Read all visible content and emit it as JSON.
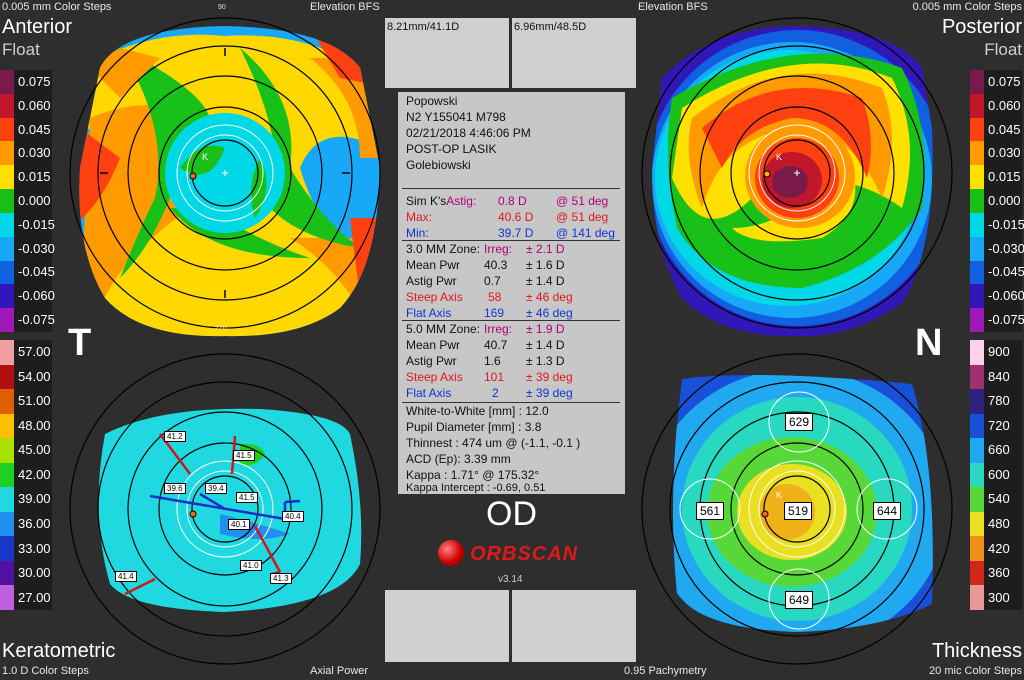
{
  "header": {
    "top_left": "0.005 mm Color Steps",
    "top_mid_left": "Elevation BFS",
    "top_mid_right": "Elevation BFS",
    "top_right": "0.005 mm Color Steps"
  },
  "quadrants": {
    "anterior": {
      "title": "Anterior",
      "subtitle": "Float"
    },
    "posterior": {
      "title": "Posterior",
      "subtitle": "Float"
    },
    "keratometric": {
      "title": "Keratometric"
    },
    "thickness": {
      "title": "Thickness"
    }
  },
  "side_letters": {
    "temporal": "T",
    "nasal": "N"
  },
  "footer": {
    "bottom_left": "1.0 D Color Steps",
    "bottom_mid_left": "Axial Power",
    "bottom_mid_right": "0.95 Pachymetry",
    "bottom_right": "20 mic Color Steps"
  },
  "scales": {
    "elevation_left": [
      "0.075",
      "0.060",
      "0.045",
      "0.030",
      "0.015",
      "0.000",
      "-0.015",
      "-0.030",
      "-0.045",
      "-0.060",
      "-0.075"
    ],
    "elevation_right": [
      "0.075",
      "0.060",
      "0.045",
      "0.030",
      "0.015",
      "0.000",
      "-0.015",
      "-0.030",
      "-0.045",
      "-0.060",
      "-0.075"
    ],
    "elevation_colors": [
      "#7a1a4a",
      "#c0182a",
      "#ff4010",
      "#ff9a00",
      "#ffe000",
      "#18c018",
      "#00d8e8",
      "#18a8f8",
      "#1060e0",
      "#3018b8",
      "#a018b8"
    ],
    "kerato": [
      "57.00",
      "54.00",
      "51.00",
      "48.00",
      "45.00",
      "42.00",
      "39.00",
      "36.00",
      "33.00",
      "30.00",
      "27.00"
    ],
    "kerato_colors": [
      "#f0a0a0",
      "#b01010",
      "#e06000",
      "#ffc000",
      "#a8e000",
      "#20d020",
      "#20d8e0",
      "#2090f0",
      "#1838c8",
      "#5010a0",
      "#c060e0"
    ],
    "thick": [
      "900",
      "840",
      "780",
      "720",
      "660",
      "600",
      "540",
      "480",
      "420",
      "360",
      "300"
    ],
    "thick_colors": [
      "#ffd0e8",
      "#a03070",
      "#302080",
      "#1850d8",
      "#20a8f0",
      "#28d8c0",
      "#58d838",
      "#e8e020",
      "#f09018",
      "#d02818",
      "#e89898"
    ]
  },
  "top_boxes": {
    "left": "8.21mm/41.1D",
    "right": "6.96mm/48.5D"
  },
  "patient": {
    "name": "Popowski",
    "id": "N2 Y155041 M798",
    "datetime": "02/21/2018 4:46:06 PM",
    "procedure": "POST-OP LASIK",
    "examiner": "Golebiowski"
  },
  "sim_k": {
    "label": "Sim K's",
    "astig_label": "Astig:",
    "astig_value": "0.8 D",
    "astig_axis": "@ 51 deg",
    "max_label": "Max:",
    "max_value": "40.6 D",
    "max_axis": "@ 51 deg",
    "min_label": "Min:",
    "min_value": "39.7 D",
    "min_axis": "@ 141 deg"
  },
  "zone3": {
    "label": "3.0 MM Zone:",
    "irreg_label": "Irreg:",
    "irreg_value": "± 2.1 D",
    "mean_label": "Mean Pwr",
    "mean_value": "40.3",
    "mean_dev": "± 1.6 D",
    "astig_label": "Astig Pwr",
    "astig_value": "0.7",
    "astig_dev": "± 1.4 D",
    "steep_label": "Steep Axis",
    "steep_value": "58",
    "steep_dev": "± 46 deg",
    "flat_label": "Flat Axis",
    "flat_value": "169",
    "flat_dev": "± 46 deg"
  },
  "zone5": {
    "label": "5.0 MM Zone:",
    "irreg_label": "Irreg:",
    "irreg_value": "± 1.9 D",
    "mean_label": "Mean Pwr",
    "mean_value": "40.7",
    "mean_dev": "± 1.4 D",
    "astig_label": "Astig Pwr",
    "astig_value": "1.6",
    "astig_dev": "± 1.3 D",
    "steep_label": "Steep Axis",
    "steep_value": "101",
    "steep_dev": "± 39 deg",
    "flat_label": "Flat Axis",
    "flat_value": "2",
    "flat_dev": "± 39 deg"
  },
  "measurements": {
    "wtw": "White-to-White [mm] : 12.0",
    "pupil": "Pupil Diameter [mm] :  3.8",
    "thinnest": "Thinnest : 474 um @ (-1.1, -0.1 )",
    "acd": "ACD (Ep): 3.39 mm",
    "kappa": "Kappa : 1.71° @ 175.32°",
    "kappa_intercept": "Kappa Intercept : -0.69, 0.51"
  },
  "eye": "OD",
  "brand": {
    "name": "ORBSCAN",
    "version": "v3.14"
  },
  "kerato_labels": [
    "41.2",
    "41.5",
    "39.6",
    "39.4",
    "41.5",
    "40.1",
    "40.4",
    "41.0",
    "41.3",
    "41.4"
  ],
  "thickness_labels": {
    "top": "629",
    "left": "561",
    "center": "519",
    "right": "644",
    "bottom": "649"
  },
  "ring_ticks": {
    "top": "90",
    "bottom": "270",
    "upper_left": "120",
    "upper_right": "60",
    "lower_left": "240",
    "lower_right": "300",
    "left": "180",
    "right": "0"
  },
  "colors": {
    "background": "#2e2e2e",
    "panel": "#c7c7c7"
  }
}
